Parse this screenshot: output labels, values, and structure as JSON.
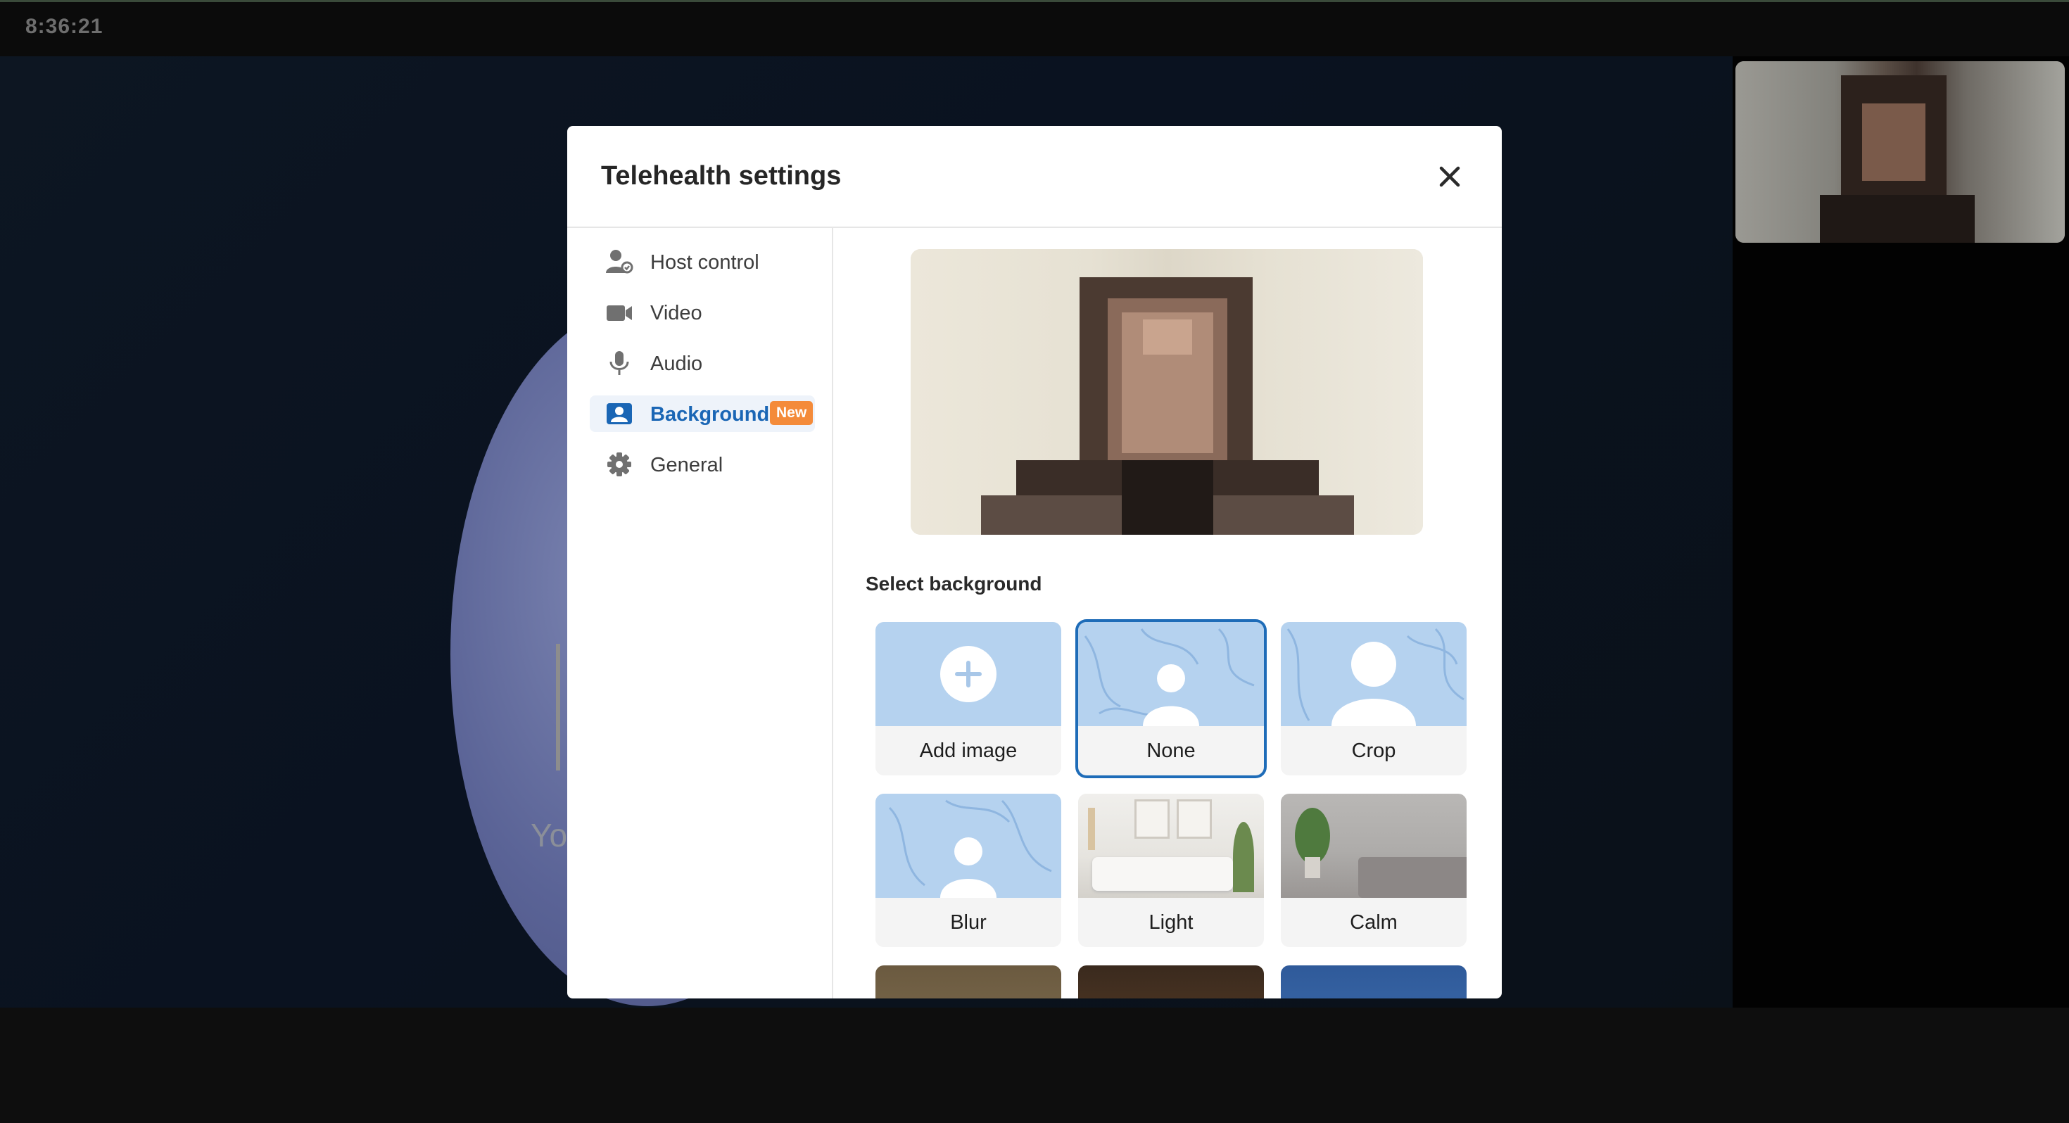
{
  "status_bar": {
    "clock": "8:36:21"
  },
  "background_call": {
    "partial_text": "Yo"
  },
  "self_view": {
    "label": "self-view-camera"
  },
  "modal": {
    "title": "Telehealth settings",
    "close_icon": "close-icon",
    "nav": [
      {
        "label": "Host control",
        "icon": "host-control-icon",
        "active": false
      },
      {
        "label": "Video",
        "icon": "video-camera-icon",
        "active": false
      },
      {
        "label": "Audio",
        "icon": "microphone-icon",
        "active": false
      },
      {
        "label": "Background",
        "icon": "background-portrait-icon",
        "active": true,
        "badge": "New"
      },
      {
        "label": "General",
        "icon": "gear-icon",
        "active": false
      }
    ],
    "section_label": "Select background",
    "backgrounds": [
      {
        "label": "Add image",
        "icon": "plus-circle-icon",
        "selected": false
      },
      {
        "label": "None",
        "icon": "person-icon",
        "selected": true
      },
      {
        "label": "Crop",
        "icon": "person-icon",
        "selected": false
      },
      {
        "label": "Blur",
        "icon": "person-icon",
        "selected": false
      },
      {
        "label": "Light",
        "icon": "living-room-image",
        "selected": false
      },
      {
        "label": "Calm",
        "icon": "sofa-room-image",
        "selected": false
      }
    ]
  },
  "colors": {
    "accent": "#1e6cb8",
    "badge": "#f48b3a",
    "tile_blue": "#b5d2ef",
    "annotation_arrow": "#1e90f0"
  }
}
